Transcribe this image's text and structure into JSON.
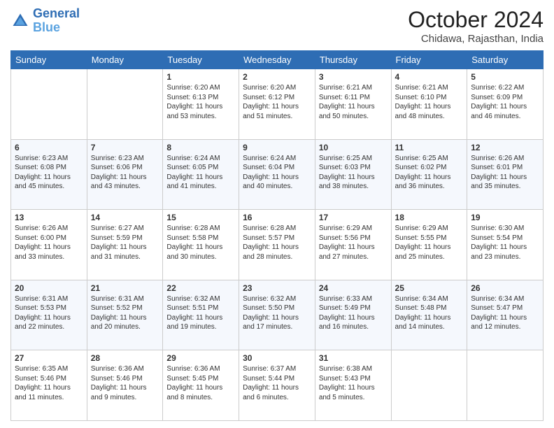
{
  "header": {
    "logo_line1": "General",
    "logo_line2": "Blue",
    "month": "October 2024",
    "location": "Chidawa, Rajasthan, India"
  },
  "days_of_week": [
    "Sunday",
    "Monday",
    "Tuesday",
    "Wednesday",
    "Thursday",
    "Friday",
    "Saturday"
  ],
  "weeks": [
    [
      {
        "day": "",
        "info": ""
      },
      {
        "day": "",
        "info": ""
      },
      {
        "day": "1",
        "info": "Sunrise: 6:20 AM\nSunset: 6:13 PM\nDaylight: 11 hours and 53 minutes."
      },
      {
        "day": "2",
        "info": "Sunrise: 6:20 AM\nSunset: 6:12 PM\nDaylight: 11 hours and 51 minutes."
      },
      {
        "day": "3",
        "info": "Sunrise: 6:21 AM\nSunset: 6:11 PM\nDaylight: 11 hours and 50 minutes."
      },
      {
        "day": "4",
        "info": "Sunrise: 6:21 AM\nSunset: 6:10 PM\nDaylight: 11 hours and 48 minutes."
      },
      {
        "day": "5",
        "info": "Sunrise: 6:22 AM\nSunset: 6:09 PM\nDaylight: 11 hours and 46 minutes."
      }
    ],
    [
      {
        "day": "6",
        "info": "Sunrise: 6:23 AM\nSunset: 6:08 PM\nDaylight: 11 hours and 45 minutes."
      },
      {
        "day": "7",
        "info": "Sunrise: 6:23 AM\nSunset: 6:06 PM\nDaylight: 11 hours and 43 minutes."
      },
      {
        "day": "8",
        "info": "Sunrise: 6:24 AM\nSunset: 6:05 PM\nDaylight: 11 hours and 41 minutes."
      },
      {
        "day": "9",
        "info": "Sunrise: 6:24 AM\nSunset: 6:04 PM\nDaylight: 11 hours and 40 minutes."
      },
      {
        "day": "10",
        "info": "Sunrise: 6:25 AM\nSunset: 6:03 PM\nDaylight: 11 hours and 38 minutes."
      },
      {
        "day": "11",
        "info": "Sunrise: 6:25 AM\nSunset: 6:02 PM\nDaylight: 11 hours and 36 minutes."
      },
      {
        "day": "12",
        "info": "Sunrise: 6:26 AM\nSunset: 6:01 PM\nDaylight: 11 hours and 35 minutes."
      }
    ],
    [
      {
        "day": "13",
        "info": "Sunrise: 6:26 AM\nSunset: 6:00 PM\nDaylight: 11 hours and 33 minutes."
      },
      {
        "day": "14",
        "info": "Sunrise: 6:27 AM\nSunset: 5:59 PM\nDaylight: 11 hours and 31 minutes."
      },
      {
        "day": "15",
        "info": "Sunrise: 6:28 AM\nSunset: 5:58 PM\nDaylight: 11 hours and 30 minutes."
      },
      {
        "day": "16",
        "info": "Sunrise: 6:28 AM\nSunset: 5:57 PM\nDaylight: 11 hours and 28 minutes."
      },
      {
        "day": "17",
        "info": "Sunrise: 6:29 AM\nSunset: 5:56 PM\nDaylight: 11 hours and 27 minutes."
      },
      {
        "day": "18",
        "info": "Sunrise: 6:29 AM\nSunset: 5:55 PM\nDaylight: 11 hours and 25 minutes."
      },
      {
        "day": "19",
        "info": "Sunrise: 6:30 AM\nSunset: 5:54 PM\nDaylight: 11 hours and 23 minutes."
      }
    ],
    [
      {
        "day": "20",
        "info": "Sunrise: 6:31 AM\nSunset: 5:53 PM\nDaylight: 11 hours and 22 minutes."
      },
      {
        "day": "21",
        "info": "Sunrise: 6:31 AM\nSunset: 5:52 PM\nDaylight: 11 hours and 20 minutes."
      },
      {
        "day": "22",
        "info": "Sunrise: 6:32 AM\nSunset: 5:51 PM\nDaylight: 11 hours and 19 minutes."
      },
      {
        "day": "23",
        "info": "Sunrise: 6:32 AM\nSunset: 5:50 PM\nDaylight: 11 hours and 17 minutes."
      },
      {
        "day": "24",
        "info": "Sunrise: 6:33 AM\nSunset: 5:49 PM\nDaylight: 11 hours and 16 minutes."
      },
      {
        "day": "25",
        "info": "Sunrise: 6:34 AM\nSunset: 5:48 PM\nDaylight: 11 hours and 14 minutes."
      },
      {
        "day": "26",
        "info": "Sunrise: 6:34 AM\nSunset: 5:47 PM\nDaylight: 11 hours and 12 minutes."
      }
    ],
    [
      {
        "day": "27",
        "info": "Sunrise: 6:35 AM\nSunset: 5:46 PM\nDaylight: 11 hours and 11 minutes."
      },
      {
        "day": "28",
        "info": "Sunrise: 6:36 AM\nSunset: 5:46 PM\nDaylight: 11 hours and 9 minutes."
      },
      {
        "day": "29",
        "info": "Sunrise: 6:36 AM\nSunset: 5:45 PM\nDaylight: 11 hours and 8 minutes."
      },
      {
        "day": "30",
        "info": "Sunrise: 6:37 AM\nSunset: 5:44 PM\nDaylight: 11 hours and 6 minutes."
      },
      {
        "day": "31",
        "info": "Sunrise: 6:38 AM\nSunset: 5:43 PM\nDaylight: 11 hours and 5 minutes."
      },
      {
        "day": "",
        "info": ""
      },
      {
        "day": "",
        "info": ""
      }
    ]
  ]
}
